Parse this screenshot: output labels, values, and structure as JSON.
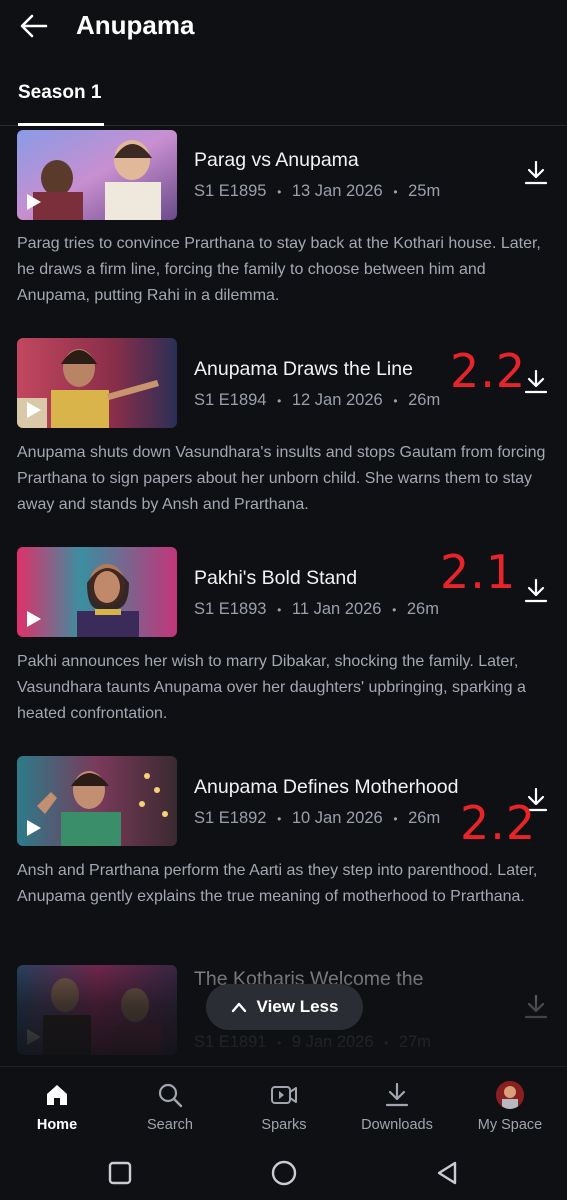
{
  "header": {
    "title": "Anupama",
    "back_icon": "arrow-left-icon"
  },
  "tabs": [
    {
      "label": "Season 1",
      "active": true
    }
  ],
  "episodes": [
    {
      "title": "Parag vs Anupama",
      "episode": "S1 E1895",
      "date": "13 Jan 2026",
      "duration": "25m",
      "description": "Parag tries to convince Prarthana to stay back at the Kothari house. Later, he draws a firm line, forcing the family to choose between him and Anupama, putting Rahi in a dilemma."
    },
    {
      "title": "Anupama Draws the Line",
      "episode": "S1 E1894",
      "date": "12 Jan 2026",
      "duration": "26m",
      "description": "Anupama shuts down Vasundhara's insults and stops Gautam from forcing Prarthana to sign papers about her unborn child. She warns them to stay away and stands by Ansh and Prarthana."
    },
    {
      "title": "Pakhi's Bold Stand",
      "episode": "S1 E1893",
      "date": "11 Jan 2026",
      "duration": "26m",
      "description": "Pakhi announces her wish to marry Dibakar, shocking the family. Later, Vasundhara taunts Anupama over her daughters' upbringing, sparking a heated confrontation."
    },
    {
      "title": "Anupama Defines Motherhood",
      "episode": "S1 E1892",
      "date": "10 Jan 2026",
      "duration": "26m",
      "description": "Ansh and Prarthana perform the Aarti as they step into parenthood. Later, Anupama gently explains the true meaning of motherhood to Prarthana."
    },
    {
      "title": "The Kotharis Welcome the",
      "episode": "S1 E1891",
      "date": "9 Jan 2026",
      "duration": "27m",
      "description": ""
    }
  ],
  "meta_separator": "•",
  "annotations": [
    "2.2",
    "2.1",
    "2.2"
  ],
  "view_less": {
    "label": "View Less"
  },
  "bottom_nav": [
    {
      "label": "Home",
      "icon": "home-icon",
      "active": true
    },
    {
      "label": "Search",
      "icon": "search-icon",
      "active": false
    },
    {
      "label": "Sparks",
      "icon": "sparks-video-icon",
      "active": false
    },
    {
      "label": "Downloads",
      "icon": "download-icon",
      "active": false
    },
    {
      "label": "My Space",
      "icon": "avatar",
      "active": false
    }
  ],
  "colors": {
    "background": "#0f1014",
    "annotation": "#e8242a",
    "meta": "#9aa0ab"
  }
}
